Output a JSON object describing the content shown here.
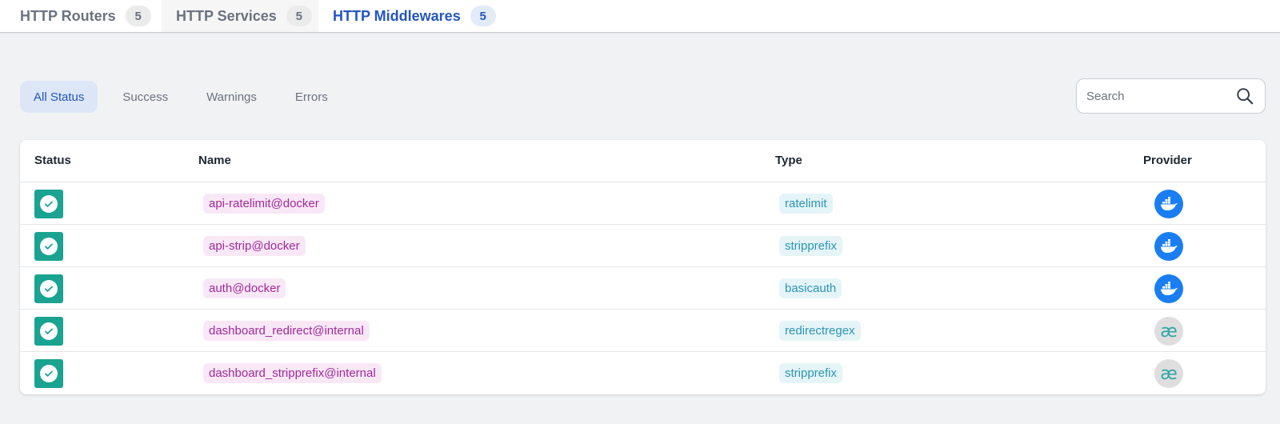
{
  "tabs": [
    {
      "label": "HTTP Routers",
      "count": "5"
    },
    {
      "label": "HTTP Services",
      "count": "5"
    },
    {
      "label": "HTTP Middlewares",
      "count": "5"
    }
  ],
  "filters": [
    "All Status",
    "Success",
    "Warnings",
    "Errors"
  ],
  "search": {
    "placeholder": "Search"
  },
  "table": {
    "headers": {
      "status": "Status",
      "name": "Name",
      "type": "Type",
      "provider": "Provider"
    },
    "rows": [
      {
        "status": "success",
        "name": "api-ratelimit@docker",
        "type": "ratelimit",
        "provider": "docker"
      },
      {
        "status": "success",
        "name": "api-strip@docker",
        "type": "stripprefix",
        "provider": "docker"
      },
      {
        "status": "success",
        "name": "auth@docker",
        "type": "basicauth",
        "provider": "docker"
      },
      {
        "status": "success",
        "name": "dashboard_redirect@internal",
        "type": "redirectregex",
        "provider": "internal"
      },
      {
        "status": "success",
        "name": "dashboard_stripprefix@internal",
        "type": "stripprefix",
        "provider": "internal"
      }
    ]
  },
  "icons": {
    "internal_glyph": "æ"
  },
  "colors": {
    "accent": "#2456bd",
    "success": "#1aa391",
    "docker": "#1a7ef2",
    "name_chip": "#a1299b",
    "type_chip": "#2b96b3"
  }
}
